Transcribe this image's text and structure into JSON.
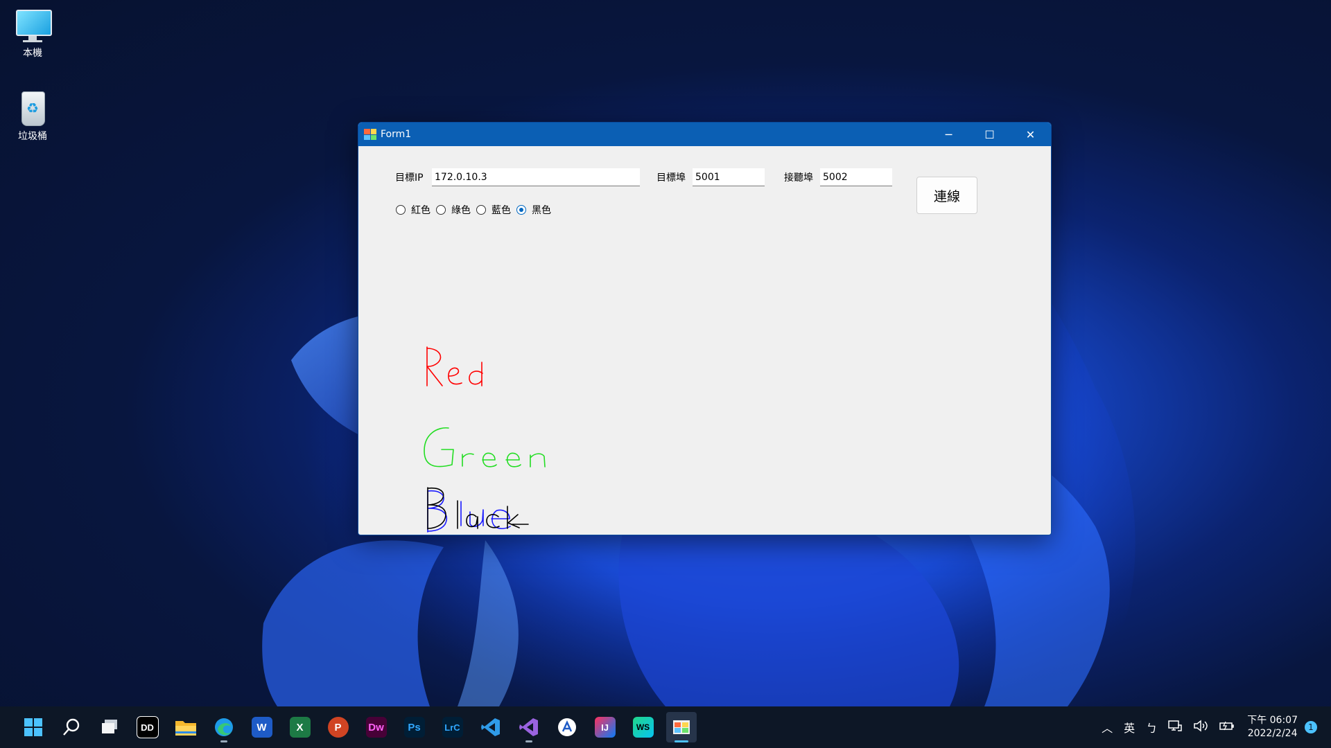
{
  "desktop": {
    "icons": [
      {
        "label": "本機",
        "icon": "computer-icon"
      },
      {
        "label": "垃圾桶",
        "icon": "recycle-bin-icon"
      }
    ]
  },
  "window": {
    "title": "Form1",
    "controls": {
      "minimize": "─",
      "maximize": "☐",
      "close": "✕"
    },
    "form": {
      "target_ip_label": "目標IP",
      "target_ip_value": "172.0.10.3",
      "target_port_label": "目標埠",
      "target_port_value": "5001",
      "listen_port_label": "接聽埠",
      "listen_port_value": "5002",
      "connect_label": "連線",
      "colors": [
        {
          "label": "紅色",
          "checked": false
        },
        {
          "label": "綠色",
          "checked": false
        },
        {
          "label": "藍色",
          "checked": false
        },
        {
          "label": "黑色",
          "checked": true
        }
      ]
    },
    "drawing": {
      "strokes": [
        {
          "text": "Red",
          "color": "#ff0000"
        },
        {
          "text": "Green",
          "color": "#22dd22"
        },
        {
          "text": "Blue",
          "color": "#1a1aff"
        },
        {
          "text": "Black",
          "color": "#000000"
        }
      ]
    }
  },
  "taskbar": {
    "apps": [
      {
        "name": "start",
        "icon": "windows-start-icon"
      },
      {
        "name": "search",
        "icon": "search-icon"
      },
      {
        "name": "task-view",
        "icon": "task-view-icon"
      },
      {
        "name": "dolby",
        "icon": "dolby-icon",
        "glyph": "DD"
      },
      {
        "name": "file-explorer",
        "icon": "folder-icon"
      },
      {
        "name": "edge",
        "icon": "edge-icon"
      },
      {
        "name": "word",
        "icon": "word-icon",
        "glyph": "W"
      },
      {
        "name": "excel",
        "icon": "excel-icon",
        "glyph": "X"
      },
      {
        "name": "powerpoint",
        "icon": "powerpoint-icon",
        "glyph": "P"
      },
      {
        "name": "dreamweaver",
        "icon": "dreamweaver-icon",
        "glyph": "Dw"
      },
      {
        "name": "photoshop",
        "icon": "photoshop-icon",
        "glyph": "Ps"
      },
      {
        "name": "lightroom",
        "icon": "lightroom-icon",
        "glyph": "LrC"
      },
      {
        "name": "vscode",
        "icon": "vscode-icon"
      },
      {
        "name": "visual-studio",
        "icon": "visual-studio-icon"
      },
      {
        "name": "app-a",
        "icon": "app-circle-icon"
      },
      {
        "name": "intellij",
        "icon": "intellij-icon",
        "glyph": "IJ"
      },
      {
        "name": "webstorm",
        "icon": "webstorm-icon",
        "glyph": "WS"
      },
      {
        "name": "form1",
        "icon": "form-app-icon"
      }
    ],
    "tray": {
      "ime": "英",
      "ime_mode": "ㄅ",
      "time": "下午 06:07",
      "date": "2022/2/24",
      "notifications": "1"
    }
  }
}
